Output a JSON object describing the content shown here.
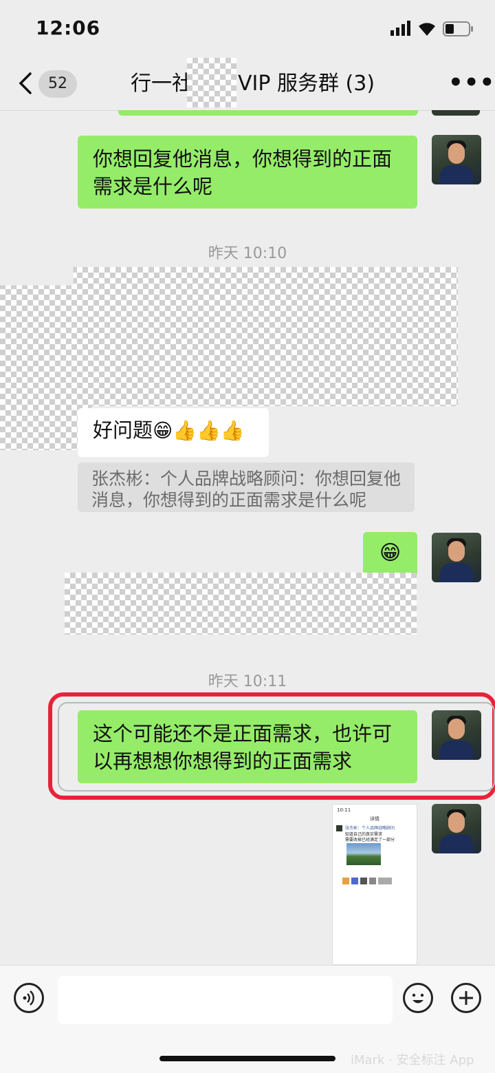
{
  "status_bar": {
    "time": "12:06"
  },
  "nav": {
    "back_count": "52",
    "title_left": "行一社",
    "title_right": "VIP 服务群 (3)",
    "more": "•••"
  },
  "messages": {
    "m1_text": "你想回复他消息，你想得到的正面需求是什么呢",
    "time1": "昨天 10:10",
    "m2_text": "好问题",
    "m2_emoji": "😁👍👍👍",
    "m2_quote": "张杰彬：个人品牌战略顾问：你想回复他消息，你想得到的正面需求是什么呢",
    "m3_emoji": "😁",
    "time2": "昨天 10:11",
    "m4_text": "这个可能还不是正面需求，也许可以再想想你想得到的正面需求"
  },
  "thumb": {
    "status_time": "10:11",
    "header": "详情",
    "name": "张杰彬：个人品牌战略顾问",
    "line1": "知道自己的真实需求",
    "line2": "需要改掉已经满足了一部分"
  },
  "watermark": "iMark · 安全标注 App",
  "colors": {
    "bubble_green": "#95ec69",
    "highlight_red": "#e8223a",
    "background": "#ededed"
  },
  "icons": [
    "chevron-left-icon",
    "signal-icon",
    "wifi-icon",
    "battery-icon",
    "more-icon",
    "voice-icon",
    "emoji-icon",
    "plus-icon"
  ]
}
